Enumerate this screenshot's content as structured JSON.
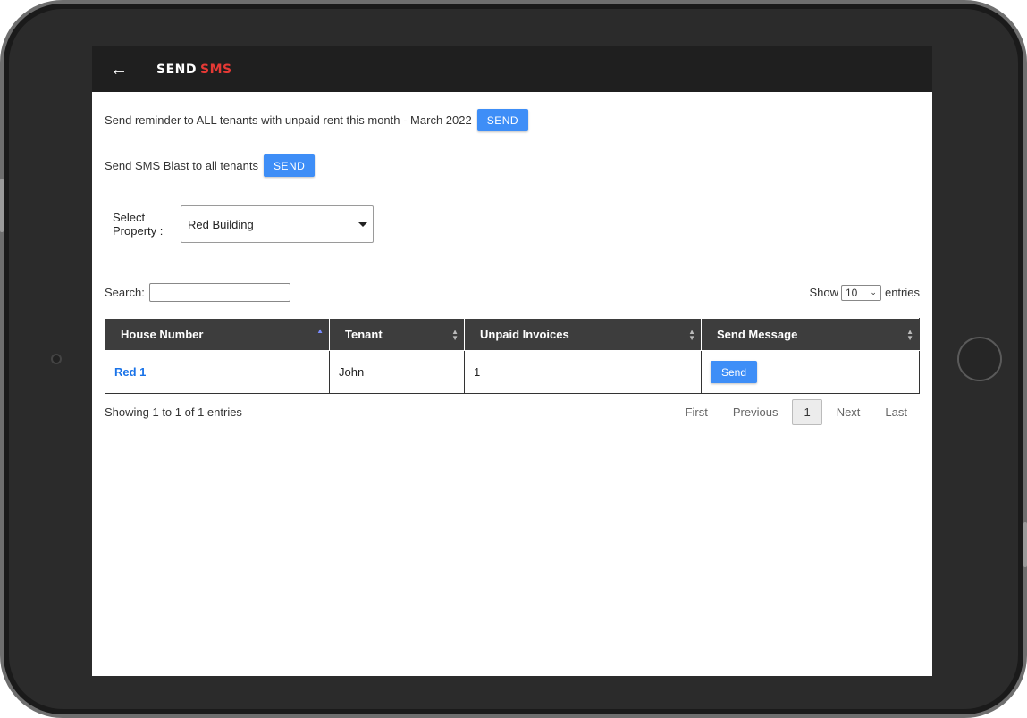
{
  "header": {
    "title_part1": "SEND",
    "title_part2": "SMS",
    "back_icon": "arrow-left-icon"
  },
  "reminder": {
    "text": "Send reminder to ALL tenants with unpaid rent this month - March 2022",
    "button_label": "SEND"
  },
  "blast": {
    "text": "Send SMS Blast to all tenants",
    "button_label": "SEND"
  },
  "property_select": {
    "label": "Select Property :",
    "selected": "Red Building"
  },
  "table_controls": {
    "search_label": "Search:",
    "search_value": "",
    "show_label": "Show",
    "entries_value": "10",
    "entries_label": "entries"
  },
  "table": {
    "columns": [
      "House Number",
      "Tenant",
      "Unpaid Invoices",
      "Send Message"
    ],
    "rows": [
      {
        "house_number": "Red 1",
        "tenant": "John",
        "unpaid_invoices": "1",
        "action_label": "Send"
      }
    ]
  },
  "footer": {
    "info": "Showing 1 to 1 of 1 entries",
    "first": "First",
    "previous": "Previous",
    "current_page": "1",
    "next": "Next",
    "last": "Last"
  },
  "colors": {
    "accent_red": "#e53935",
    "button_blue": "#3e8ef7",
    "header_dark": "#1f1f1f",
    "table_header": "#3d3d3d"
  }
}
